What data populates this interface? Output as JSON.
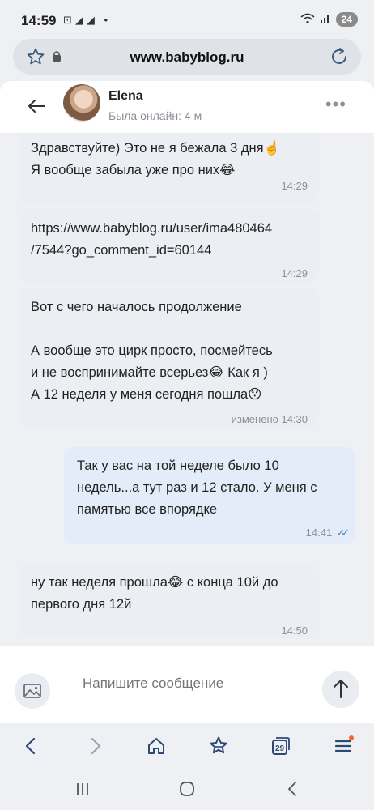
{
  "status_bar": {
    "time": "14:59",
    "left_icons": "⊡◢◢ •",
    "battery": "24"
  },
  "browser": {
    "url": "www.babyblog.ru"
  },
  "chat": {
    "contact_name": "Elena",
    "contact_status": "Была онлайн: 4 м",
    "messages": [
      {
        "text": "Здравствуйте) Это не я бежала 3 дня☝️\nЯ вообще забыла уже про них😂",
        "time": "14:29"
      },
      {
        "text": "https://www.babyblog.ru/user/ima480464\n/7544?go_comment_id=60144",
        "time": "14:29"
      },
      {
        "text": "Вот с чего началось продолжение\n\nА вообще это цирк просто, посмейтесь\nи не воспринимайте всерьез😂 Как я )\nА 12 неделя у меня сегодня пошла😯",
        "time": "изменено 14:30"
      },
      {
        "text": "Так у вас на той неделе было 10\nнедель...а тут раз и 12 стало. У меня с\nпамятью все впорядке",
        "time": "14:41"
      },
      {
        "text": "ну так неделя прошла😂 с конца 10й до\nпервого дня 12й",
        "time": "14:50"
      }
    ],
    "composer_placeholder": "Напишите сообщение"
  },
  "bottom_nav": {
    "tabs_count": "29"
  },
  "colors": {
    "incoming_bubble": "#ebeef2",
    "outgoing_bubble": "#e3ecf8",
    "read_check": "#4e86c4",
    "notification_dot": "#f26b21"
  }
}
